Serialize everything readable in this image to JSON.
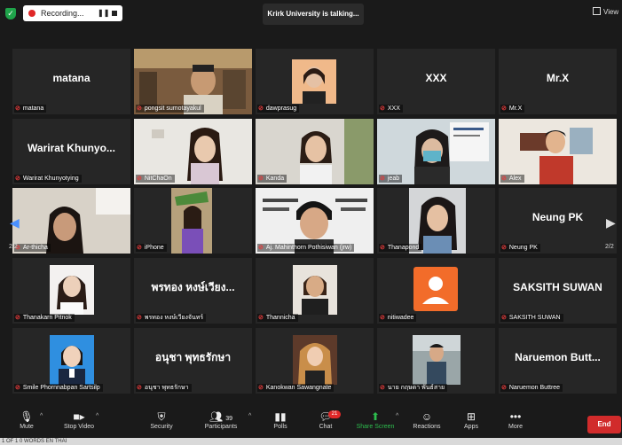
{
  "topbar": {
    "recording_label": "Recording...",
    "talking_label": "Krirk University is talking...",
    "view_label": "View"
  },
  "navigation": {
    "left_page": "2/2",
    "right_page": "2/2"
  },
  "participants": [
    {
      "big": "matana",
      "name": "matana"
    },
    {
      "big": "",
      "name": "pongsit sumotayakul"
    },
    {
      "big": "",
      "name": "dawprasug"
    },
    {
      "big": "XXX",
      "name": "XXX"
    },
    {
      "big": "Mr.X",
      "name": "Mr.X"
    },
    {
      "big": "Warirat  Khunyo...",
      "name": "Warirat Khunyotying"
    },
    {
      "big": "",
      "name": "NitChaOn"
    },
    {
      "big": "",
      "name": "Kanda"
    },
    {
      "big": "",
      "name": "jeab"
    },
    {
      "big": "",
      "name": "Alex"
    },
    {
      "big": "",
      "name": "Ar-thicha"
    },
    {
      "big": "",
      "name": "iPhone"
    },
    {
      "big": "",
      "name": "Aj. Mahinthorn Pothisiwan (jrw)"
    },
    {
      "big": "",
      "name": "Thanapond"
    },
    {
      "big": "Neung PK",
      "name": "Neung PK"
    },
    {
      "big": "",
      "name": "Thanakarn Pitnok"
    },
    {
      "big": "พรทอง หงษ์เวียง...",
      "name": "พรทอง หงษ์เวียงจันทร์"
    },
    {
      "big": "",
      "name": "Thannicha"
    },
    {
      "big": "",
      "name": "nitiwadee"
    },
    {
      "big": "SAKSITH SUWAN",
      "name": "SAKSITH SUWAN"
    },
    {
      "big": "",
      "name": "Smile Phornnabpan Sartsilp"
    },
    {
      "big": "อนุชา พุทธรักษา",
      "name": "อนุชา พุทธรักษา"
    },
    {
      "big": "",
      "name": "Kanokwan Sawangnate"
    },
    {
      "big": "",
      "name": "นาย กฤษดา พันธ์สาย"
    },
    {
      "big": "Naruemon  Butt...",
      "name": "Naruemon Buttree"
    }
  ],
  "toolbar": {
    "mute": "Mute",
    "stop_video": "Stop Video",
    "security": "Security",
    "participants": "Participants",
    "participants_count": "39",
    "polls": "Polls",
    "chat": "Chat",
    "chat_badge": "21",
    "share_screen": "Share Screen",
    "reactions": "Reactions",
    "apps": "Apps",
    "more": "More",
    "end": "End"
  },
  "statusbar": {
    "text": "1 OF 1   0 WORDS   EN   THAI"
  },
  "colors": {
    "background": "#1a1a1a",
    "tile": "#262626",
    "mic_off": "#e23b3b",
    "share": "#2dbd4e",
    "end": "#d12b2b",
    "nav_arrow": "#4a90ff"
  }
}
